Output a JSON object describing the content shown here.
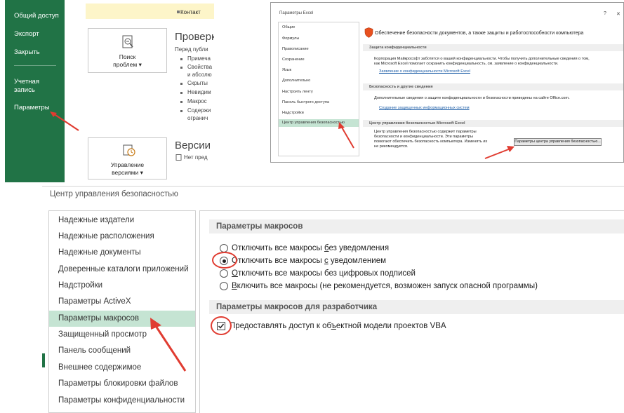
{
  "backstage": {
    "nav": [
      "Общий доступ",
      "Экспорт",
      "Закрыть",
      "Учетная\nзапись",
      "Параметры"
    ],
    "top_item": "Контакт",
    "check_tile": {
      "line1": "Поиск",
      "line2": "проблем ▾"
    },
    "check_heading": "Проверк",
    "check_desc": "Перед публи",
    "check_bullets": [
      "Примеча",
      "Свойства",
      "и абсолю",
      "Скрыты",
      "Невидим",
      "Макрос",
      "Содержи",
      "огранич"
    ],
    "versions_tile": {
      "line1": "Управление",
      "line2": "версиями ▾"
    },
    "versions_heading": "Версии",
    "versions_desc": "Нет пред"
  },
  "options": {
    "title": "Параметры Excel",
    "help": "?",
    "close": "✕",
    "nav": [
      "Общие",
      "Формулы",
      "Правописание",
      "Сохранение",
      "Язык",
      "Дополнительно",
      "Настроить ленту",
      "Панель быстрого доступа",
      "Надстройки",
      "Центр управления безопасностью"
    ],
    "header": "Обеспечение безопасности документов, а также защиты и работоспособности компьютера",
    "privacy_section": "Защита конфиденциальности",
    "privacy_text1": "Корпорация Майкрософт заботится о вашей конфиденциальности. Чтобы получить дополнительные сведения о том,",
    "privacy_text2": "как Microsoft Excel помогает сохранить конфиденциальность, см. заявление о конфиденциальности.",
    "privacy_link": "Заявление о конфиденциальности Microsoft Excel",
    "security_section": "Безопасность и другие сведения",
    "security_text": "Дополнительные сведения о защите конфиденциальности и безопасности приведены на сайте Office.com.",
    "security_link": "Создание защищенных информационных систем",
    "tc_section": "Центр управления безопасностью Microsoft Excel",
    "tc_text": [
      "Центр управления безопасностью содержит параметры",
      "безопасности и конфиденциальности. Эти параметры",
      "помогают обеспечить безопасность компьютера. Изменять их",
      "не рекомендуется."
    ],
    "tc_button": "Параметры центра управления безопасностью..."
  },
  "trust": {
    "title": "Центр управления безопасностью",
    "nav": [
      "Надежные издатели",
      "Надежные расположения",
      "Надежные документы",
      "Доверенные каталоги приложений",
      "Надстройки",
      "Параметры ActiveX",
      "Параметры макросов",
      "Защищенный просмотр",
      "Панель сообщений",
      "Внешнее содержимое",
      "Параметры блокировки файлов",
      "Параметры конфиденциальности"
    ],
    "macro_section": "Параметры макросов",
    "options": [
      {
        "pre": "Отключить все макросы ",
        "u": "б",
        "post": "ез уведомления",
        "selected": false
      },
      {
        "pre": "Отключить все макросы ",
        "u": "с",
        "post": " уведомлением",
        "selected": true
      },
      {
        "pre": "",
        "u": "О",
        "post": "тключить все макросы без цифровых подписей",
        "selected": false
      },
      {
        "pre": "",
        "u": "В",
        "post": "ключить все макросы (не рекомендуется, возможен запуск опасной программы)",
        "selected": false
      }
    ],
    "dev_section": "Параметры макросов для разработчика",
    "vba": {
      "pre": "Предоставлять доступ к об",
      "u": "ъ",
      "post": "ектной модели проектов VBA",
      "checked": true
    }
  }
}
